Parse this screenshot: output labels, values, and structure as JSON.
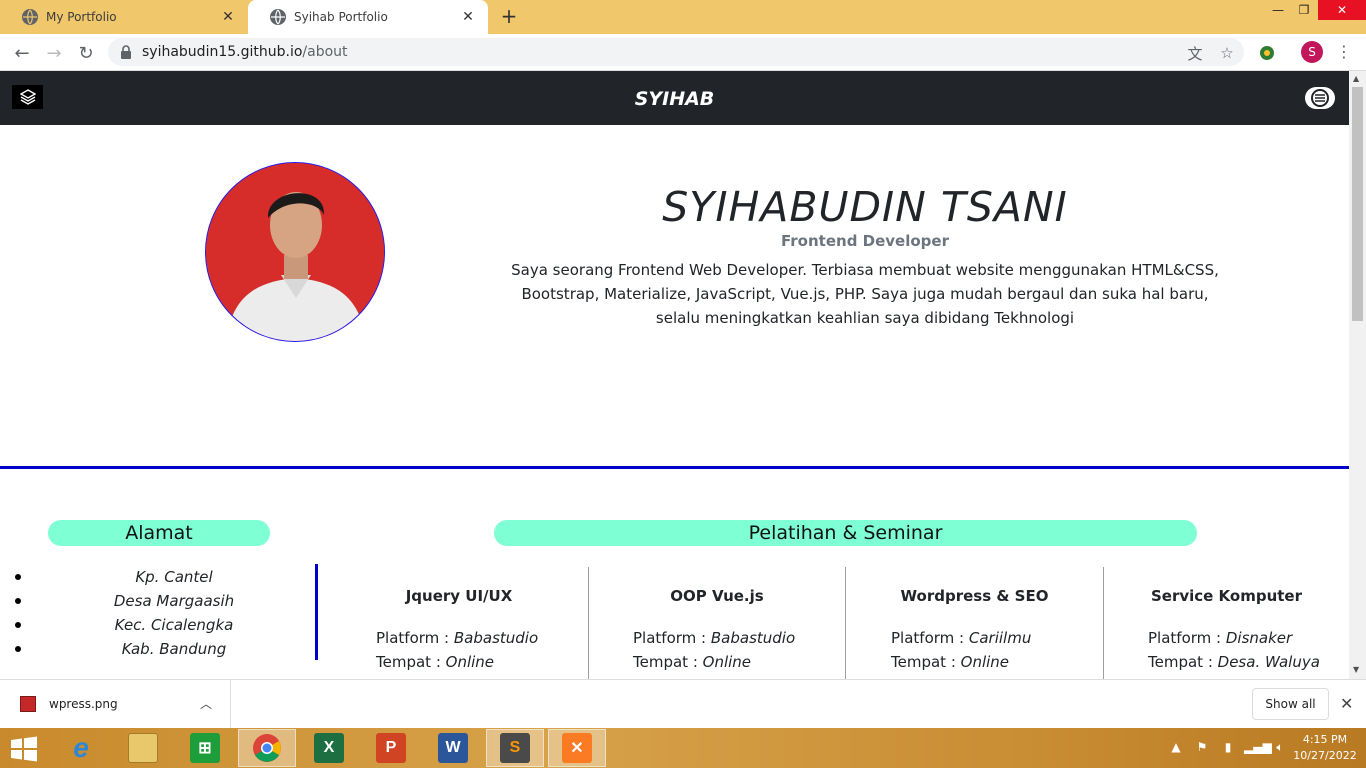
{
  "browser": {
    "tabs": [
      {
        "title": "My Portfolio",
        "active": false
      },
      {
        "title": "Syihab Portfolio",
        "active": true
      }
    ],
    "url_host": "syihabudin15.github.io",
    "url_path": "/about",
    "profile_initial": "S"
  },
  "site": {
    "brand": "SYIHAB",
    "name": "SYIHABUDIN TSANI",
    "role": "Frontend Developer",
    "bio": "Saya seorang Frontend Web Developer. Terbiasa membuat website menggunakan HTML&CSS, Bootstrap, Materialize, JavaScript, Vue.js, PHP. Saya juga mudah bergaul dan suka hal baru, selalu meningkatkan keahlian saya dibidang Tekhnologi",
    "address_heading": "Alamat",
    "address": [
      "Kp. Cantel",
      "Desa Margaasih",
      "Kec. Cicalengka",
      "Kab. Bandung"
    ],
    "training_heading": "Pelatihan & Seminar",
    "platform_label": "Platform :",
    "place_label": "Tempat :",
    "trainings": [
      {
        "title": "Jquery UI/UX",
        "platform": "Babastudio",
        "place": "Online"
      },
      {
        "title": "OOP Vue.js",
        "platform": "Babastudio",
        "place": "Online"
      },
      {
        "title": "Wordpress & SEO",
        "platform": "Cariilmu",
        "place": "Online"
      },
      {
        "title": "Service Komputer",
        "platform": "Disnaker",
        "place": "Desa. Waluya"
      }
    ]
  },
  "downloads": {
    "file": "wpress.png",
    "show_all": "Show all"
  },
  "taskbar": {
    "apps": [
      "internet-explorer",
      "file-explorer",
      "store",
      "chrome",
      "excel",
      "powerpoint",
      "word",
      "sublime-text",
      "xampp"
    ],
    "active_app": "chrome",
    "time": "4:15 PM",
    "date": "10/27/2022"
  },
  "colors": {
    "accent_blue": "#0000cc",
    "pill": "#7fffd4",
    "navbar": "#212529",
    "tab_strip": "#f0c76b"
  }
}
